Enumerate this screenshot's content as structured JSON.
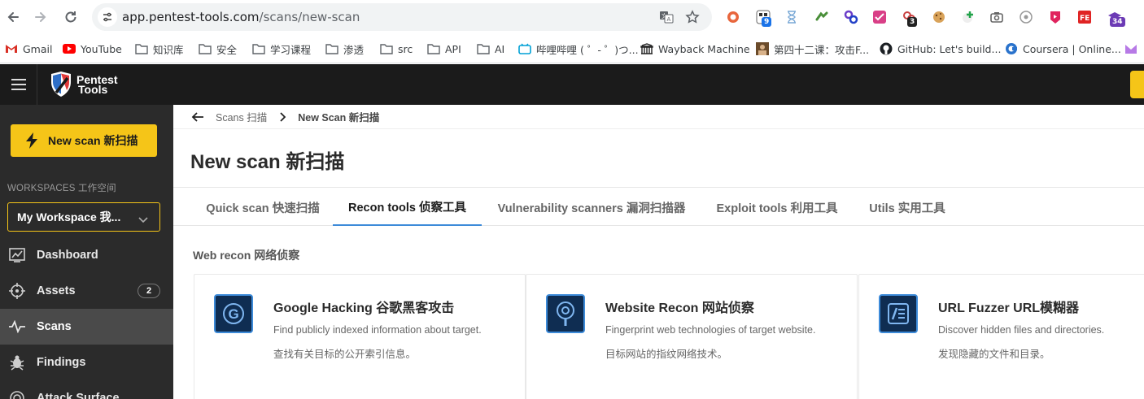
{
  "browser": {
    "url_host": "app.pentest-tools.com",
    "url_path": "/scans/new-scan",
    "extension_badges": [
      "9",
      "3",
      "34"
    ]
  },
  "bookmarks": [
    {
      "label": "Gmail",
      "icon": "gmail-icon"
    },
    {
      "label": "YouTube",
      "icon": "youtube-icon"
    },
    {
      "label": "知识库",
      "icon": "folder-icon"
    },
    {
      "label": "安全",
      "icon": "folder-icon"
    },
    {
      "label": "学习课程",
      "icon": "folder-icon"
    },
    {
      "label": "渗透",
      "icon": "folder-icon"
    },
    {
      "label": "src",
      "icon": "folder-icon"
    },
    {
      "label": "API",
      "icon": "folder-icon"
    },
    {
      "label": "AI",
      "icon": "folder-icon"
    },
    {
      "label": "哔哩哔哩 ( ゜- ゜)つ...",
      "icon": "bilibili-icon"
    },
    {
      "label": "Wayback Machine",
      "icon": "wayback-icon"
    },
    {
      "label": "第四十二课：攻击F...",
      "icon": "avatar-icon"
    },
    {
      "label": "GitHub: Let's build...",
      "icon": "github-icon"
    },
    {
      "label": "Coursera | Online...",
      "icon": "coursera-icon"
    }
  ],
  "app": {
    "logo_line1": "Pentest",
    "logo_line2": "Tools"
  },
  "sidebar": {
    "new_scan_label": "New scan  新扫描",
    "workspaces_label": "WORKSPACES 工作空间",
    "workspace_name": "My Workspace 我...",
    "nav": [
      {
        "label": "Dashboard",
        "icon": "chart-icon"
      },
      {
        "label": "Assets",
        "icon": "target-icon",
        "badge": "2"
      },
      {
        "label": "Scans",
        "icon": "pulse-icon",
        "active": true
      },
      {
        "label": "Findings",
        "icon": "bug-icon"
      },
      {
        "label": "Attack Surface",
        "icon": "radar-icon"
      }
    ]
  },
  "main": {
    "breadcrumb": {
      "parent": "Scans  扫描",
      "current": "New Scan 新扫描"
    },
    "title": "New scan 新扫描",
    "tabs": [
      {
        "label": "Quick scan 快速扫描"
      },
      {
        "label": "Recon tools 侦察工具",
        "active": true
      },
      {
        "label": "Vulnerability scanners 漏洞扫描器"
      },
      {
        "label": "Exploit tools 利用工具"
      },
      {
        "label": "Utils 实用工具"
      }
    ],
    "section_title": "Web recon 网络侦察",
    "cards": [
      {
        "title": "Google Hacking 谷歌黑客攻击",
        "desc": "Find publicly indexed information about target.",
        "desc_cn": "查找有关目标的公开索引信息。",
        "icon": "google-g-icon"
      },
      {
        "title": "Website Recon 网站侦察",
        "desc": "Fingerprint web technologies of target website.",
        "desc_cn": "目标网站的指纹网络技术。",
        "icon": "magnifier-icon"
      },
      {
        "title": "URL Fuzzer URL模糊器",
        "desc": "Discover hidden files and directories.",
        "desc_cn": "发现隐藏的文件和目录。",
        "icon": "fuzzer-icon"
      }
    ]
  }
}
